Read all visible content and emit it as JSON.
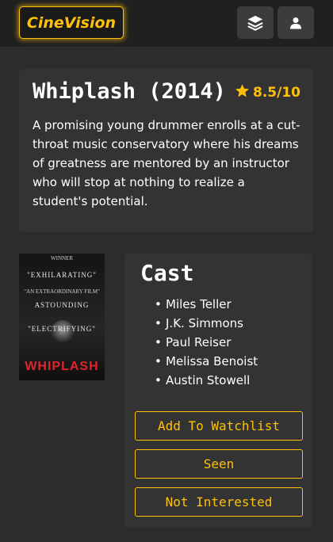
{
  "navbar": {
    "brand": "CineVision",
    "layers_icon": "layers-icon",
    "user_icon": "user-icon"
  },
  "movie": {
    "title": "Whiplash (2014)",
    "rating": "8.5/10",
    "rating_icon": "star-icon",
    "synopsis": "A promising young drummer enrolls at a cut-throat music conservatory where his dreams of greatness are mentored by an instructor who will stop at nothing to realize a student's potential."
  },
  "poster": {
    "winner": "WINNER",
    "exhilarating": "\"EXHILARATING\"",
    "extraordinary": "\"AN EXTRAORDINARY FILM\"",
    "astounding": "ASTOUNDING",
    "electrifying": "\"ELECTRIFYING\"",
    "title": "WHIPLASH"
  },
  "cast": {
    "heading": "Cast",
    "members": [
      "Miles Teller",
      "J.K. Simmons",
      "Paul Reiser",
      "Melissa Benoist",
      "Austin Stowell"
    ]
  },
  "actions": {
    "watchlist": "Add To Watchlist",
    "seen": "Seen",
    "not_interested": "Not Interested"
  },
  "colors": {
    "accent": "#ffc107",
    "background": "#2c2c2c",
    "navbar": "#202020",
    "card": "#333333"
  }
}
